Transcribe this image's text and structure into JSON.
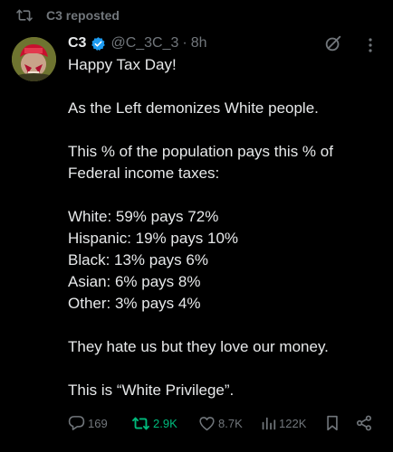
{
  "repost_banner": {
    "icon": "repost-icon",
    "text": "C3 reposted"
  },
  "post": {
    "author_name": "C3",
    "verified_icon": "verified-badge-icon",
    "handle": "@C_3C_3",
    "separator": "·",
    "time": "8h",
    "grok_icon": "grok-icon",
    "more_icon": "more-icon",
    "lines": [
      "Happy Tax Day!",
      "",
      "As the Left demonizes White people.",
      "",
      "This % of the population pays this % of",
      "Federal income taxes:",
      "",
      "White: 59% pays 72%",
      "Hispanic: 19% pays 10%",
      "Black: 13% pays 6%",
      "Asian: 6% pays 8%",
      "Other: 3% pays 4%",
      "",
      "They hate us but they love our money.",
      "",
      "This is “White Privilege”."
    ]
  },
  "actions": {
    "reply": {
      "icon": "reply-icon",
      "count": "169"
    },
    "repost": {
      "icon": "repost-icon",
      "count": "2.9K",
      "color": "#00ba7c"
    },
    "like": {
      "icon": "heart-icon",
      "count": "8.7K"
    },
    "views": {
      "icon": "views-icon",
      "count": "122K"
    },
    "bookmark": {
      "icon": "bookmark-icon"
    },
    "share": {
      "icon": "share-icon"
    }
  },
  "colors": {
    "background": "#000000",
    "text": "#e7e9ea",
    "muted": "#71767b",
    "verified": "#1d9bf0",
    "repost_active": "#00ba7c"
  }
}
